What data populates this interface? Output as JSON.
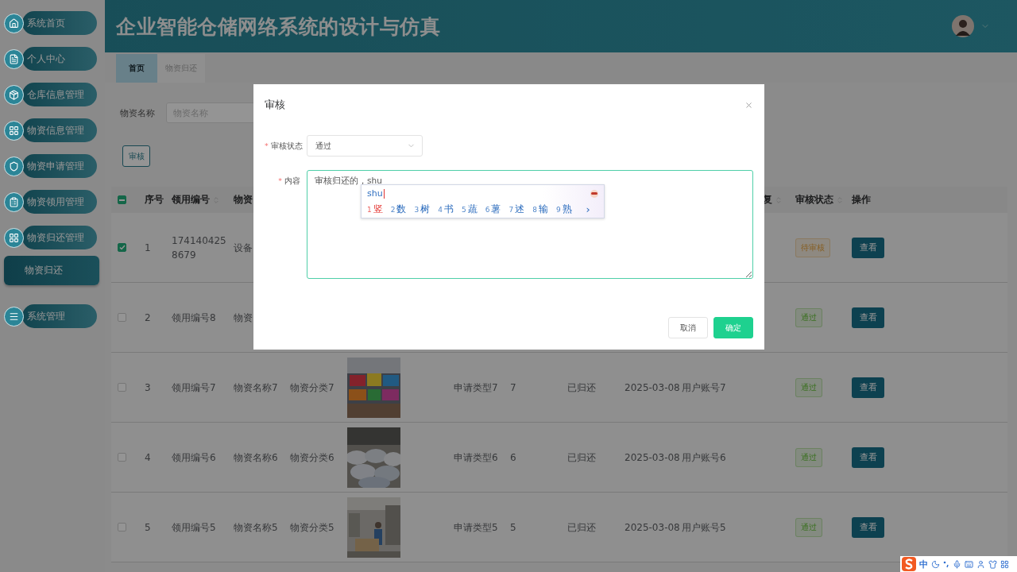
{
  "sidebar": {
    "items": [
      {
        "label": "系统首页",
        "selected": false
      },
      {
        "label": "个人中心",
        "selected": false
      },
      {
        "label": "仓库信息管理",
        "selected": false
      },
      {
        "label": "物资信息管理",
        "selected": false
      },
      {
        "label": "物资申请管理",
        "selected": false
      },
      {
        "label": "物资领用管理",
        "selected": false
      },
      {
        "label": "物资归还管理",
        "selected": false,
        "children": [
          {
            "label": "物资归还",
            "selected": true
          }
        ]
      },
      {
        "label": "系统管理",
        "selected": false
      }
    ]
  },
  "header": {
    "title": "企业智能仓储网络系统的设计与仿真"
  },
  "tabs": [
    {
      "label": "首页",
      "selected": true
    },
    {
      "label": "物资归还",
      "selected": false
    }
  ],
  "search": {
    "label": "物资名称",
    "placeholder": "物资名称"
  },
  "toolbar": {
    "buttons": [
      "审核"
    ]
  },
  "table": {
    "select_all": {
      "indeterminate": true
    },
    "columns": [
      {
        "label": "序号",
        "sortable": false
      },
      {
        "label": "领用编号",
        "sortable": true
      },
      {
        "label": "物资",
        "sortable": false
      },
      null,
      null,
      null,
      null,
      null,
      null,
      null,
      {
        "label": "复",
        "sortable": true
      },
      {
        "label": "审核状态",
        "sortable": true
      },
      {
        "label": "操作",
        "sortable": false
      }
    ],
    "rows": [
      {
        "checked": true,
        "cells": [
          "1",
          "1741404258679",
          "设备",
          null,
          null,
          null,
          null,
          null,
          null,
          null,
          null
        ],
        "review_status": {
          "text": "待审核",
          "kind": "pending"
        },
        "action": "查看"
      },
      {
        "checked": false,
        "cells": [
          "2",
          "领用编号8",
          "物资",
          null,
          null,
          null,
          null,
          null,
          null,
          null,
          null
        ],
        "review_status": {
          "text": "通过",
          "kind": "passed"
        },
        "action": "查看"
      },
      {
        "checked": false,
        "cells": [
          "3",
          "领用编号7",
          "物资名称7",
          "物资分类7",
          {
            "kind": "picture"
          },
          "申请类型7",
          "7",
          "已归还",
          "2025-03-08",
          "用户账号7",
          null
        ],
        "review_status": {
          "text": "通过",
          "kind": "passed"
        },
        "action": "查看"
      },
      {
        "checked": false,
        "cells": [
          "4",
          "领用编号6",
          "物资名称6",
          "物资分类6",
          {
            "kind": "picture"
          },
          "申请类型6",
          "6",
          "已归还",
          "2025-03-08",
          "用户账号6",
          null
        ],
        "review_status": {
          "text": "通过",
          "kind": "passed"
        },
        "action": "查看"
      },
      {
        "checked": false,
        "cells": [
          "5",
          "领用编号5",
          "物资名称5",
          "物资分类5",
          {
            "kind": "picture"
          },
          "申请类型5",
          "5",
          "已归还",
          "2025-03-08",
          "用户账号5",
          null
        ],
        "review_status": {
          "text": "通过",
          "kind": "passed"
        },
        "action": "查看"
      }
    ]
  },
  "dialog": {
    "title": "审核",
    "fields": [
      {
        "kind": "select",
        "label": "审核状态",
        "required_mark": "*",
        "value": "通过"
      },
      {
        "kind": "textarea",
        "label": "内容",
        "required_mark": "*",
        "value": "审核归还的，shu"
      }
    ],
    "buttons": [
      {
        "label": "取消",
        "kind": "default"
      },
      {
        "label": "确定",
        "kind": "primary"
      }
    ]
  },
  "ime_popup": {
    "composition": "shu",
    "candidates": [
      {
        "number": "1",
        "text": "竖",
        "selected": true
      },
      {
        "number": "2",
        "text": "数",
        "selected": false
      },
      {
        "number": "3",
        "text": "树",
        "selected": false
      },
      {
        "number": "4",
        "text": "书",
        "selected": false
      },
      {
        "number": "5",
        "text": "蔬",
        "selected": false
      },
      {
        "number": "6",
        "text": "薯",
        "selected": false
      },
      {
        "number": "7",
        "text": "述",
        "selected": false
      },
      {
        "number": "8",
        "text": "输",
        "selected": false
      },
      {
        "number": "9",
        "text": "熟",
        "selected": false
      }
    ],
    "next": "›"
  },
  "ime_toolbar": {
    "mode": "中"
  }
}
